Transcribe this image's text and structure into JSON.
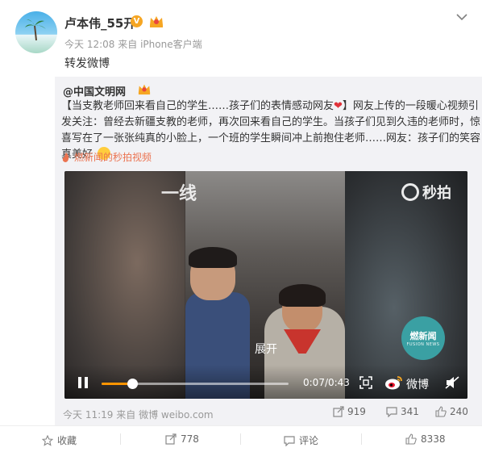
{
  "user": {
    "name": "卢本伟_55开",
    "verified_mark": "V",
    "time": "今天 12:08",
    "source_prefix": "来自",
    "source": "iPhone客户端"
  },
  "post_text": "转发微博",
  "original": {
    "author": "@中国文明网",
    "text_main": "【当支教老师回来看自己的学生……孩子们的表情感动网友",
    "heart": "❤",
    "text_rest": "】网友上传的一段暖心视频引发关注：曾经去新疆支教的老师，再次回来看自己的学生。当孩子们见到久违的老师时，惊喜写在了一张张纯真的小脸上，一个班的学生瞬间冲上前抱住老师……网友：孩子们的笑容真美好",
    "video_link": "燃新闻的秒拍视频",
    "time": "今天 11:19",
    "source_prefix": "来自",
    "source": "微博 weibo.com",
    "stats": {
      "reposts": "919",
      "comments": "341",
      "likes": "240"
    }
  },
  "video": {
    "watermark_left": "一线",
    "brand": "秒拍",
    "news_badge_main": "燃新闻",
    "news_badge_sub": "FUSION NEWS",
    "expand_label": "展开",
    "time_display": "0:07/0:43",
    "progress": 0.163,
    "weibo_label": "微博",
    "accent": "#ff9500"
  },
  "footer": {
    "favorite": "收藏",
    "repost": "778",
    "comment": "评论",
    "like": "8338"
  },
  "colors": {
    "link": "#eb7350",
    "meta": "#999999",
    "repost_bg": "#f2f2f5"
  }
}
